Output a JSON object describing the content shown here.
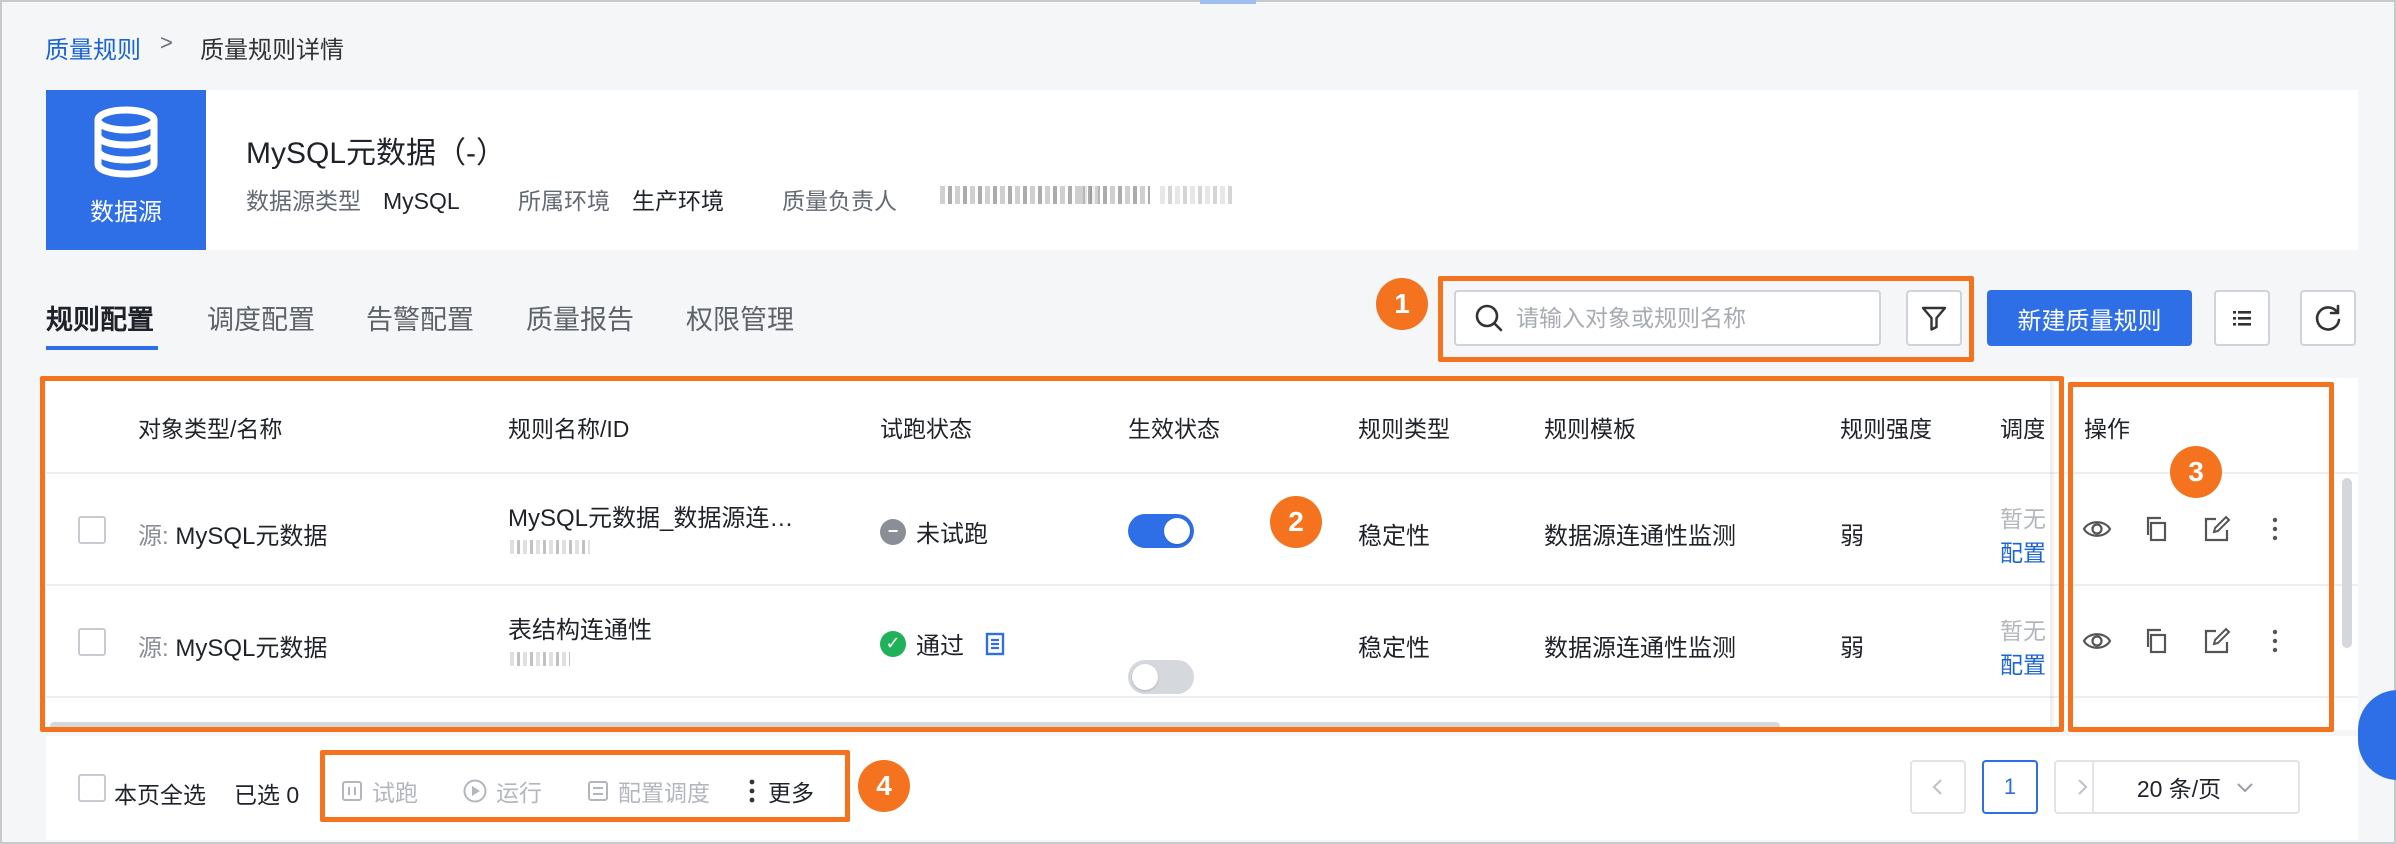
{
  "breadcrumb": {
    "parent": "质量规则",
    "separator": ">",
    "current": "质量规则详情"
  },
  "datasource": {
    "tile_label": "数据源",
    "title": "MySQL元数据（-）",
    "type_label": "数据源类型",
    "type_value": "MySQL",
    "env_label": "所属环境",
    "env_value": "生产环境",
    "owner_label": "质量负责人"
  },
  "tabs": [
    {
      "label": "规则配置",
      "active": true
    },
    {
      "label": "调度配置"
    },
    {
      "label": "告警配置"
    },
    {
      "label": "质量报告"
    },
    {
      "label": "权限管理"
    }
  ],
  "toolbar": {
    "search_placeholder": "请输入对象或规则名称",
    "create_label": "新建质量规则"
  },
  "annotations": [
    "1",
    "2",
    "3",
    "4"
  ],
  "table": {
    "headers": [
      "对象类型/名称",
      "规则名称/ID",
      "试跑状态",
      "生效状态",
      "规则类型",
      "规则模板",
      "规则强度",
      "调度",
      "操作"
    ],
    "rows": [
      {
        "source_prefix": "源:",
        "object": "MySQL元数据",
        "rule_name": "MySQL元数据_数据源连…",
        "trial_status": "未试跑",
        "enabled": true,
        "rule_type": "稳定性",
        "template": "数据源连通性监测",
        "strength": "弱",
        "sched_none": "暂无",
        "sched_link": "配置"
      },
      {
        "source_prefix": "源:",
        "object": "MySQL元数据",
        "rule_name": "表结构连通性",
        "trial_status": "通过",
        "enabled": false,
        "rule_type": "稳定性",
        "template": "数据源连通性监测",
        "strength": "弱",
        "sched_none": "暂无",
        "sched_link": "配置"
      }
    ]
  },
  "footer": {
    "select_all": "本页全选",
    "selected": "已选 0",
    "trial": "试跑",
    "run": "运行",
    "schedule": "配置调度",
    "more": "更多",
    "current_page": "1",
    "page_size": "20 条/页"
  },
  "colors": {
    "primary": "#2e6fe8",
    "annotation": "#f5731f",
    "success": "#1fb25a"
  }
}
